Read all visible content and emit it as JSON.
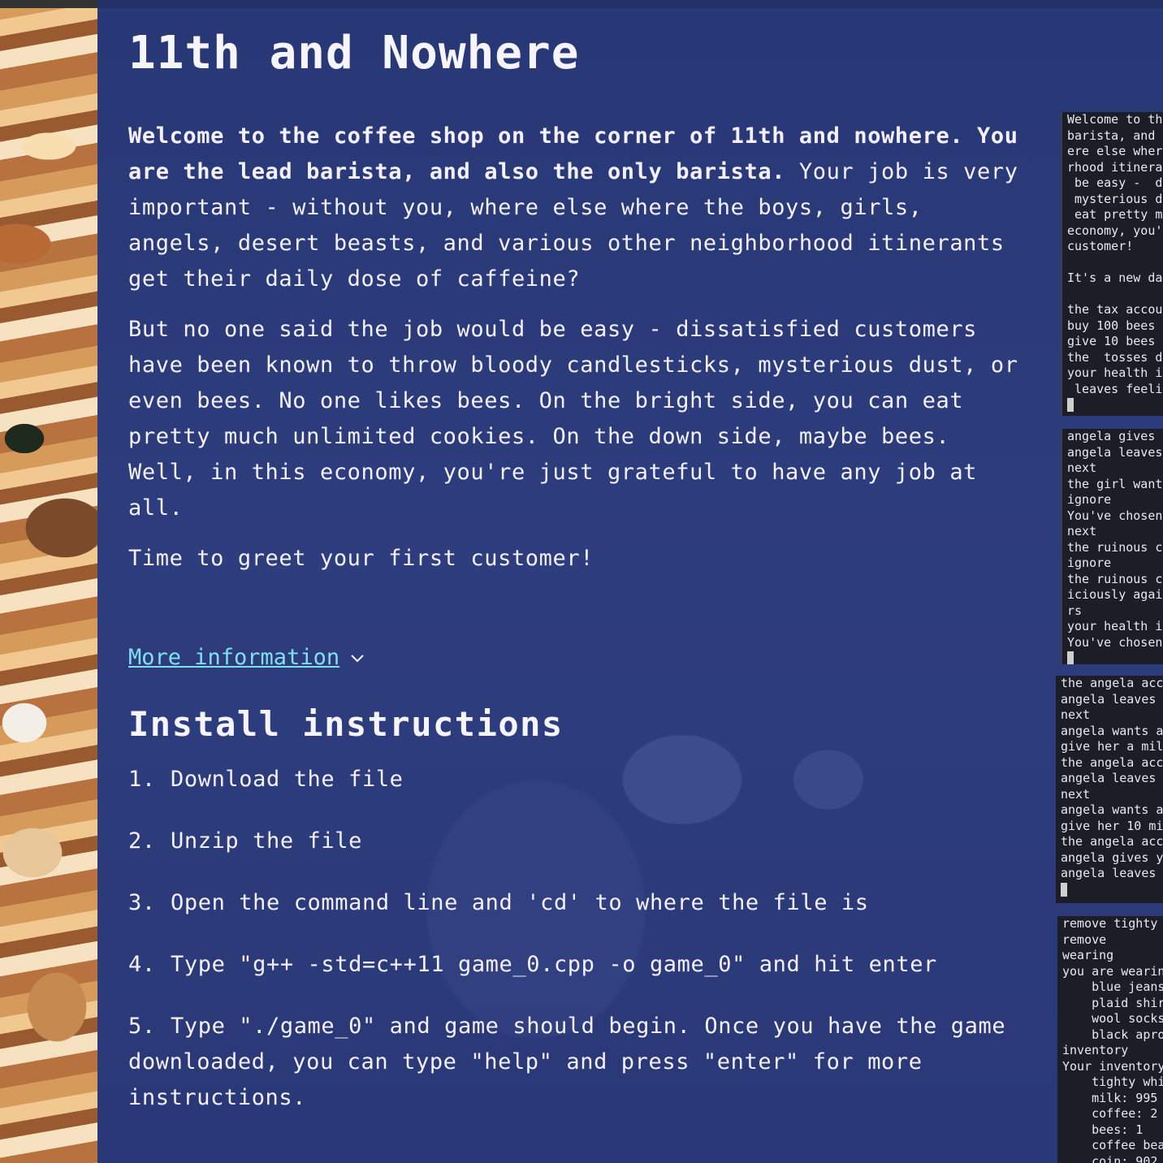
{
  "title": "11th and Nowhere",
  "intro": {
    "bold": "Welcome to the coffee shop on the  corner of 11th and nowhere. You are the lead barista, and also the only barista.",
    "rest": " Your job is very important - without you, where else where the boys, girls, angels, desert beasts, and various other neighborhood itinerants get their daily dose of caffeine?"
  },
  "para2": "But no one said the job would be easy -  dissatisfied customers have been known to throw bloody candlesticks, mysterious dust, or even bees. No one likes  bees. On the bright side, you can eat pretty much unlimited cookies. On the down side, maybe bees. Well, in this economy, you're just grateful to have any job at all.",
  "para3": "Time to  greet your first customer!",
  "more_link": "More information",
  "install": {
    "heading": "Install instructions",
    "steps": [
      {
        "num": "1.",
        "text": "Download the file"
      },
      {
        "num": "2.",
        "text": "Unzip the file"
      },
      {
        "num": "3.",
        "text": "Open the command line and 'cd' to where the file is"
      },
      {
        "num": "4.",
        "text": "Type \"g++ -std=c++11 game_0.cpp -o game_0\" and hit enter"
      },
      {
        "num": "5.",
        "text": "Type \"./game_0\" and game should begin. Once you have the game  downloaded, you can type \"help\" and press \"enter\" for more instructions."
      }
    ]
  },
  "terminals": {
    "t1": [
      "Welcome to the",
      "barista, and a",
      "ere else where",
      "rhood itineran",
      " be easy -  di",
      " mysterious du",
      " eat pretty mu",
      "economy, you'r",
      "customer!",
      "",
      "It's a new day",
      "",
      "the tax accoun",
      "buy 100 bees",
      "give 10 bees",
      "the  tosses do",
      "your health is",
      " leaves feelin"
    ],
    "t2": [
      "angela gives",
      "angela leaves",
      "next",
      "the girl wants",
      "ignore",
      "You've chosen",
      "next",
      "the ruinous cr",
      "ignore",
      "the ruinous cr",
      "iciously again",
      "rs",
      "your health is",
      "You've chosen"
    ],
    "t3": [
      "the angela acc",
      "angela leaves t",
      "next",
      "angela wants a",
      "give her a mil",
      "the angela acc",
      "angela leaves t",
      "next",
      "angela wants a",
      "give her 10 mi",
      "the angela acc",
      "angela gives yo",
      "angela leaves t"
    ],
    "t4": [
      "remove tighty w",
      "remove",
      "wearing",
      "you are wearin",
      "    blue jeans",
      "    plaid shirt",
      "    wool socks",
      "    black apron",
      "inventory",
      "Your inventory:",
      "    tighty whit",
      "    milk: 995",
      "    coffee: 2",
      "    bees: 1",
      "    coffee bean",
      "    coin: 902"
    ]
  }
}
